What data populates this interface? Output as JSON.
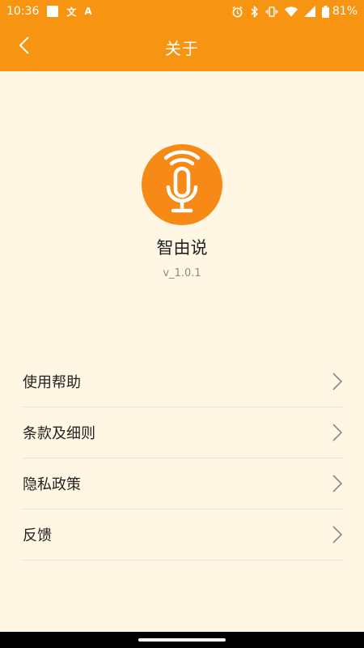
{
  "status_bar": {
    "time": "10:36",
    "notification_glyphs": [
      "文",
      "A"
    ],
    "battery_percent": "81%"
  },
  "header": {
    "title": "关于",
    "back_icon": "chevron-left-icon"
  },
  "app": {
    "name": "智由说",
    "version": "v_1.0.1",
    "logo_icon": "microphone-icon"
  },
  "menu": {
    "items": [
      {
        "label": "使用帮助",
        "icon": "chevron-right-icon"
      },
      {
        "label": "条款及细则",
        "icon": "chevron-right-icon"
      },
      {
        "label": "隐私政策",
        "icon": "chevron-right-icon"
      },
      {
        "label": "反馈",
        "icon": "chevron-right-icon"
      }
    ]
  },
  "colors": {
    "accent": "#F79412",
    "logo_bg": "#F78A17",
    "background": "#FFF7E4"
  }
}
